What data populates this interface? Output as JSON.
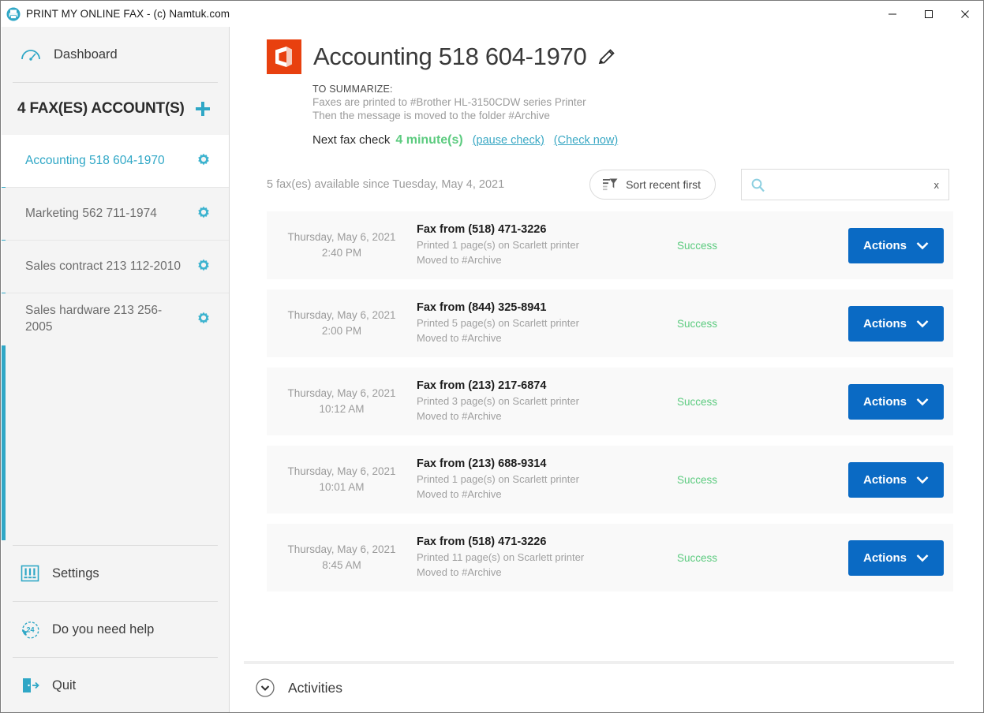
{
  "window": {
    "title": "PRINT MY ONLINE FAX - (c) Namtuk.com",
    "icon": "app-printer-icon",
    "controls": {
      "minimize": "minimize",
      "maximize": "maximize",
      "close": "close"
    }
  },
  "sidebar": {
    "dashboard": {
      "label": "Dashboard",
      "icon": "gauge-icon"
    },
    "accounts_header": {
      "title": "4 FAX(ES) ACCOUNT(S)",
      "add_icon": "plus-icon"
    },
    "accounts": [
      {
        "label": "Accounting 518 604-1970",
        "selected": true,
        "icon": "gear-icon"
      },
      {
        "label": "Marketing 562 711-1974",
        "selected": false,
        "icon": "gear-icon"
      },
      {
        "label": "Sales contract 213 112-2010",
        "selected": false,
        "icon": "gear-icon"
      },
      {
        "label": "Sales hardware 213 256-2005",
        "selected": false,
        "icon": "gear-icon"
      }
    ],
    "bottom": [
      {
        "label": "Settings",
        "icon": "sliders-icon"
      },
      {
        "label": "Do you need help",
        "icon": "support-24-icon"
      },
      {
        "label": "Quit",
        "icon": "exit-door-icon"
      }
    ]
  },
  "header": {
    "logo_icon": "office-logo-icon",
    "title": "Accounting 518 604-1970",
    "edit_icon": "pencil-icon",
    "summary_caption": "TO SUMMARIZE:",
    "summary_line1": "Faxes are printed to #Brother HL-3150CDW series Printer",
    "summary_line2": "Then the message is moved to the folder #Archive",
    "next_check_label": "Next fax check",
    "next_check_value": "4 minute(s)",
    "pause_link": "(pause check)",
    "check_now_link": "(Check now)"
  },
  "toolbar": {
    "available_text": "5 fax(es) available since Tuesday, May 4, 2021",
    "sort_label": "Sort recent first",
    "sort_icon": "sort-filter-icon",
    "search_icon": "search-icon",
    "search_value": "",
    "search_placeholder": "",
    "search_clear": "x"
  },
  "faxes": [
    {
      "date": "Thursday, May 6, 2021",
      "time": "2:40 PM",
      "title": "Fax from (518) 471-3226",
      "sub1": "Printed 1 page(s) on Scarlett printer",
      "sub2": "Moved to #Archive",
      "status": "Success",
      "action_label": "Actions"
    },
    {
      "date": "Thursday, May 6, 2021",
      "time": "2:00 PM",
      "title": "Fax from (844) 325-8941",
      "sub1": "Printed 5 page(s) on Scarlett printer",
      "sub2": "Moved to #Archive",
      "status": "Success",
      "action_label": "Actions"
    },
    {
      "date": "Thursday, May 6, 2021",
      "time": "10:12 AM",
      "title": "Fax from (213) 217-6874",
      "sub1": "Printed 3 page(s) on Scarlett printer",
      "sub2": "Moved to #Archive",
      "status": "Success",
      "action_label": "Actions"
    },
    {
      "date": "Thursday, May 6, 2021",
      "time": "10:01 AM",
      "title": "Fax from (213) 688-9314",
      "sub1": "Printed 1 page(s) on Scarlett printer",
      "sub2": "Moved to #Archive",
      "status": "Success",
      "action_label": "Actions"
    },
    {
      "date": "Thursday, May 6, 2021",
      "time": "8:45 AM",
      "title": "Fax from (518) 471-3226",
      "sub1": "Printed 11 page(s) on Scarlett printer",
      "sub2": "Moved to #Archive",
      "status": "Success",
      "action_label": "Actions"
    }
  ],
  "activities": {
    "label": "Activities",
    "icon": "chevron-down-circle-icon"
  },
  "colors": {
    "accent_teal": "#2fa7c6",
    "action_blue": "#0a6ac4",
    "success_green": "#5ccb7f",
    "office_orange": "#e8400f",
    "row_bg": "#f9f9f9"
  }
}
